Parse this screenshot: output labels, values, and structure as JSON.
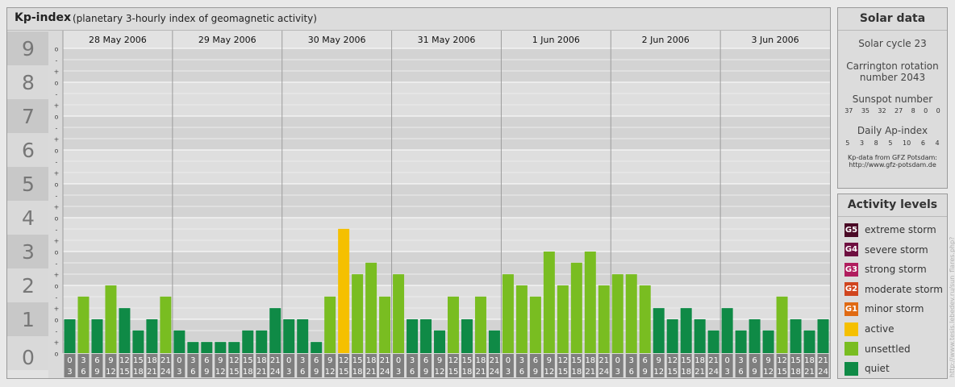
{
  "header": {
    "title": "Kp-index",
    "subtitle": "(planetary 3-hourly index of geomagnetic activity)"
  },
  "chart_data": {
    "type": "bar",
    "title": "Kp-index",
    "subtitle": "(planetary 3-hourly index of geomagnetic activity)",
    "ylim": [
      0,
      9
    ],
    "y_major_ticks": [
      "0",
      "1",
      "2",
      "3",
      "4",
      "5",
      "6",
      "7",
      "8",
      "9"
    ],
    "y_minor_ticks": [
      "+",
      "o",
      "-"
    ],
    "days": [
      "28 May 2006",
      "29 May 2006",
      "30 May 2006",
      "31 May 2006",
      "1 Jun 2006",
      "2 Jun 2006",
      "3 Jun 2006"
    ],
    "interval_top_labels": [
      "0",
      "3",
      "6",
      "9",
      "12",
      "15",
      "18",
      "21"
    ],
    "interval_bottom_labels": [
      "3",
      "6",
      "9",
      "12",
      "15",
      "18",
      "21",
      "24"
    ],
    "values": [
      1.0,
      1.67,
      1.0,
      2.0,
      1.33,
      0.67,
      1.0,
      1.67,
      0.67,
      0.33,
      0.33,
      0.33,
      0.33,
      0.67,
      0.67,
      1.33,
      1.0,
      1.0,
      0.33,
      1.67,
      3.67,
      2.33,
      2.67,
      1.67,
      2.33,
      1.0,
      1.0,
      0.67,
      1.67,
      1.0,
      1.67,
      0.67,
      2.33,
      2.0,
      1.67,
      3.0,
      2.0,
      2.67,
      3.0,
      2.0,
      2.33,
      2.33,
      2.0,
      1.33,
      1.0,
      1.33,
      1.0,
      0.67,
      1.33,
      0.67,
      1.0,
      0.67,
      1.67,
      1.0,
      0.67,
      1.0
    ],
    "colors": {
      "quiet": "#0f8a46",
      "unsettled": "#79bd21",
      "active": "#f5c000"
    },
    "grid": true
  },
  "solar": {
    "title": "Solar data",
    "cycle": "Solar cycle 23",
    "carrington_line1": "Carrington rotation",
    "carrington_line2": "number 2043",
    "sunspot_label": "Sunspot number",
    "sunspot_values": [
      "37",
      "35",
      "32",
      "27",
      "8",
      "0",
      "0"
    ],
    "ap_label": "Daily Ap-index",
    "ap_values": [
      "5",
      "3",
      "8",
      "5",
      "10",
      "6",
      "4"
    ],
    "source_line1": "Kp-data from GFZ Potsdam:",
    "source_line2": "http://www.gfz-potsdam.de"
  },
  "activity": {
    "title": "Activity levels",
    "levels": [
      {
        "code": "G5",
        "label": "extreme storm",
        "color": "#4a0a26"
      },
      {
        "code": "G4",
        "label": "severe storm",
        "color": "#6e0f40"
      },
      {
        "code": "G3",
        "label": "strong storm",
        "color": "#b01d5e"
      },
      {
        "code": "G2",
        "label": "moderate storm",
        "color": "#d0451e"
      },
      {
        "code": "G1",
        "label": "minor storm",
        "color": "#e06a12"
      },
      {
        "code": "",
        "label": "active",
        "color": "#f5c000"
      },
      {
        "code": "",
        "label": "unsettled",
        "color": "#79bd21"
      },
      {
        "code": "",
        "label": "quiet",
        "color": "#0f8a46"
      }
    ]
  },
  "watermark": "http://www.tesis.lebedev.ru/sun_flares.php?"
}
